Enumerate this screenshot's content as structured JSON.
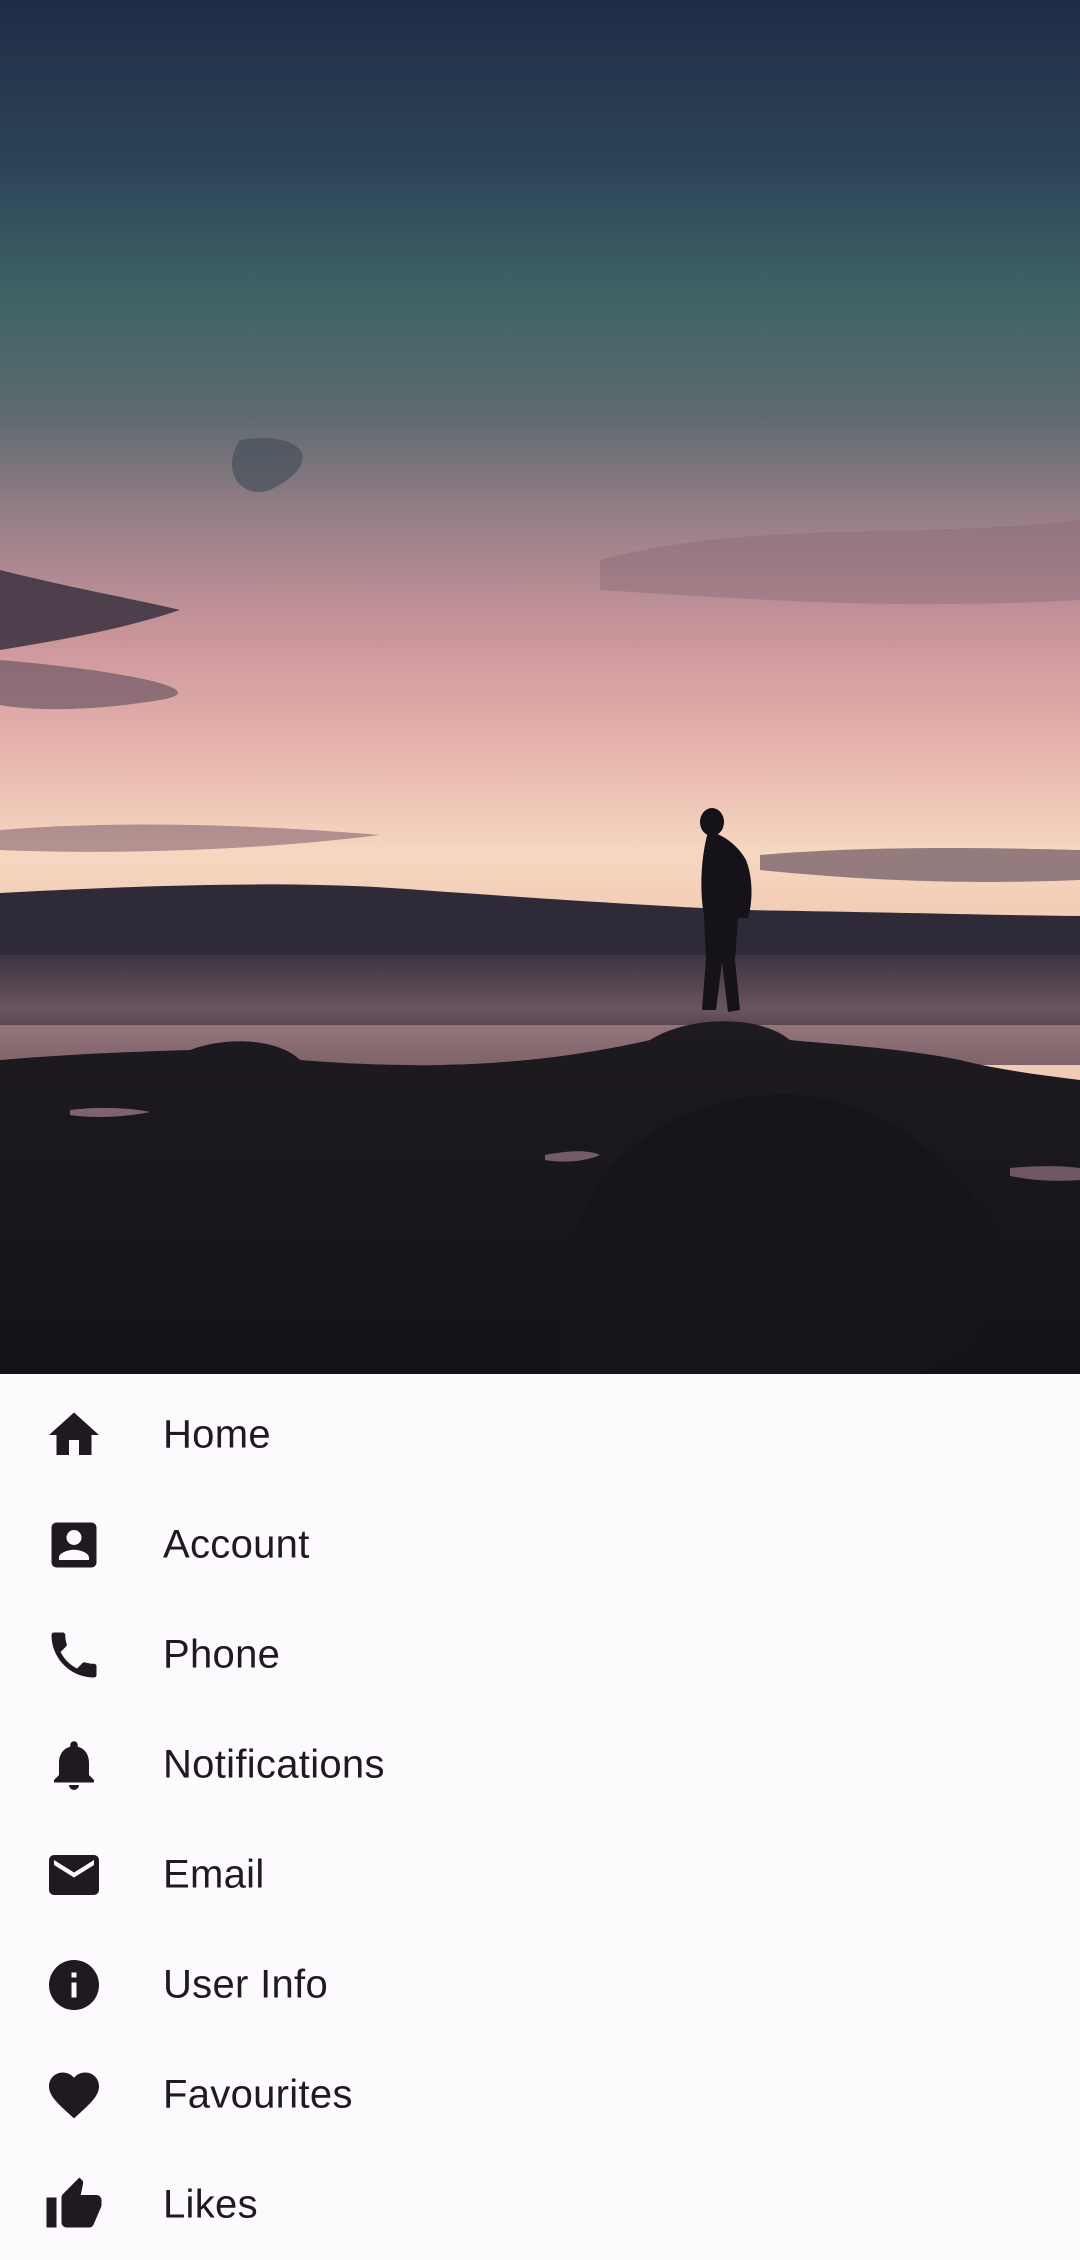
{
  "header": {
    "image_description_name": "sunset-beach-photo"
  },
  "menu": {
    "items": [
      {
        "label": "Home",
        "icon": "home-icon"
      },
      {
        "label": "Account",
        "icon": "account-box-icon"
      },
      {
        "label": "Phone",
        "icon": "phone-icon"
      },
      {
        "label": "Notifications",
        "icon": "bell-icon"
      },
      {
        "label": "Email",
        "icon": "mail-icon"
      },
      {
        "label": "User Info",
        "icon": "info-icon"
      },
      {
        "label": "Favourites",
        "icon": "heart-icon"
      },
      {
        "label": "Likes",
        "icon": "thumb-up-icon"
      }
    ]
  },
  "colors": {
    "background": "#fcfafd",
    "text": "#1e1a20",
    "icon": "#1e1a20"
  }
}
